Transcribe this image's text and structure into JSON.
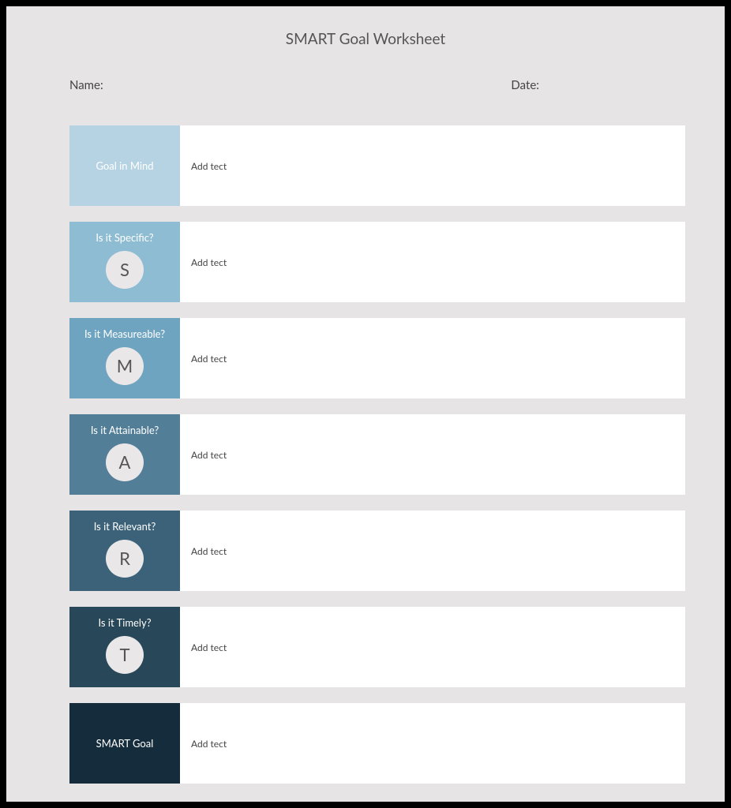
{
  "title": "SMART Goal Worksheet",
  "header": {
    "name_label": "Name:",
    "date_label": "Date:"
  },
  "rows": [
    {
      "label": "Goal in Mind",
      "letter": "",
      "placeholder": "Add tect",
      "bg": "bg-0"
    },
    {
      "label": "Is it Specific?",
      "letter": "S",
      "placeholder": "Add tect",
      "bg": "bg-1"
    },
    {
      "label": "Is it Measureable?",
      "letter": "M",
      "placeholder": "Add tect",
      "bg": "bg-2"
    },
    {
      "label": "Is it Attainable?",
      "letter": "A",
      "placeholder": "Add tect",
      "bg": "bg-3"
    },
    {
      "label": "Is it Relevant?",
      "letter": "R",
      "placeholder": "Add tect",
      "bg": "bg-4"
    },
    {
      "label": "Is it Timely?",
      "letter": "T",
      "placeholder": "Add tect",
      "bg": "bg-5"
    },
    {
      "label": "SMART Goal",
      "letter": "",
      "placeholder": "Add tect",
      "bg": "bg-6"
    }
  ]
}
